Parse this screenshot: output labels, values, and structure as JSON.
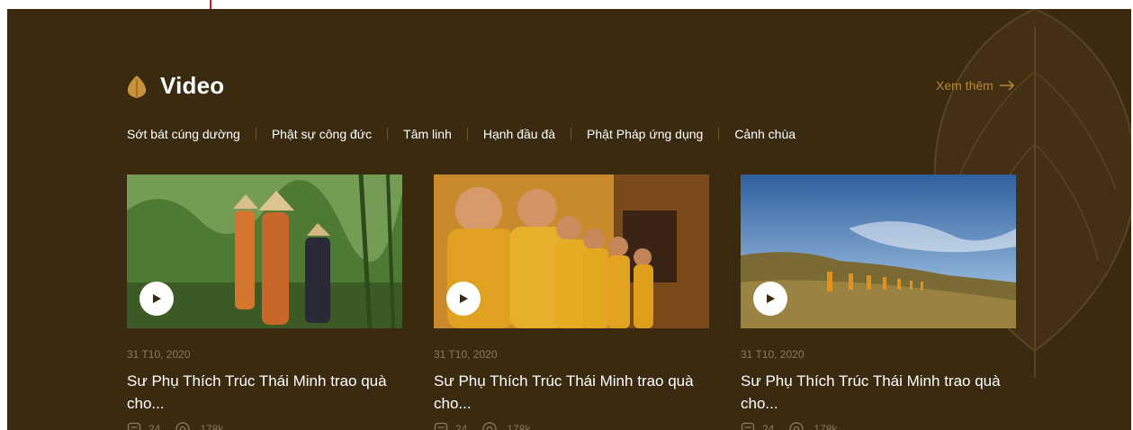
{
  "section": {
    "title": "Video",
    "more_label": "Xem thêm",
    "icon": "bodhi-leaf-icon",
    "accent_color": "#b8882f",
    "background_color": "#3a2a10"
  },
  "categories": [
    {
      "label": "Sớt bát cúng dường"
    },
    {
      "label": "Phật sự công đức"
    },
    {
      "label": "Tâm linh"
    },
    {
      "label": "Hạnh đầu đà"
    },
    {
      "label": "Phật Pháp ứng dụng"
    },
    {
      "label": "Cảnh chùa"
    }
  ],
  "videos": [
    {
      "date": "31 T10, 2020",
      "title": "Sư Phụ Thích Trúc Thái Minh trao quà cho...",
      "comments": "24",
      "views": "178k",
      "thumbnail": "monks-walking-forest"
    },
    {
      "date": "31 T10, 2020",
      "title": "Sư Phụ Thích Trúc Thái Minh trao quà cho...",
      "comments": "24",
      "views": "178k",
      "thumbnail": "monks-praying"
    },
    {
      "date": "31 T10, 2020",
      "title": "Sư Phụ Thích Trúc Thái Minh trao quà cho...",
      "comments": "24",
      "views": "178k",
      "thumbnail": "monks-on-hill"
    }
  ]
}
